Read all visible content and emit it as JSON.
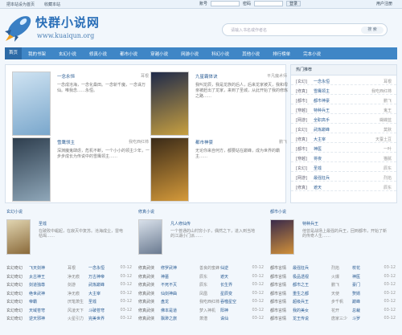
{
  "topbar": {
    "left": [
      "把本站设为首页",
      "收藏本站"
    ],
    "user_label": "账号",
    "pass_label": "密码",
    "login": "登录",
    "register": "用户注册"
  },
  "header": {
    "title": "快群小说网",
    "subtitle": "www.kuaiqun.org"
  },
  "search": {
    "placeholder": "请输入书名或作者名",
    "button": "搜 索"
  },
  "nav": [
    "首页",
    "我的书架",
    "玄幻小说",
    "修真小说",
    "都市小说",
    "穿越小说",
    "网游小说",
    "科幻小说",
    "其他小说",
    "排行榜单",
    "完本小说"
  ],
  "featured": [
    {
      "title": "一念永恒",
      "author": "耳根",
      "desc": "一念成沧海，一念化桑田。一念斩千魔，一念诛万仙。唯我念……永恒。"
    },
    {
      "title": "九星霸体诀",
      "author": "平凡魔术师",
      "desc": "我叫龙辰，我是龙族的后人，后来龙家被灭，我和母亲被赶出了龙家，来到了圣城，从此开始了我的修炼之路……"
    },
    {
      "title": "雪鹰领主",
      "author": "我吃西红柿",
      "desc": "深渊魔鬼肆虐，危机不断，一个小小的领主少年，一步步成长为传说中的雪鹰领主……"
    },
    {
      "title": "都市神豪",
      "author": "鹏飞",
      "desc": "无论你来自何方，都要站在巅峰，成为世界的霸主……"
    }
  ],
  "ranking": {
    "title": "热门推荐",
    "rows": [
      {
        "cat": "[玄幻]",
        "name": "一念永恒",
        "author": "耳根"
      },
      {
        "cat": "[修真]",
        "name": "雪鹰领主",
        "author": "我吃西红柿"
      },
      {
        "cat": "[都市]",
        "name": "都市神豪",
        "author": "鹏飞"
      },
      {
        "cat": "[穿越]",
        "name": "特种兵王",
        "author": "鬼王"
      },
      {
        "cat": "[网游]",
        "name": "全职高手",
        "author": "蝴蝶蓝"
      },
      {
        "cat": "[玄幻]",
        "name": "武炼巅峰",
        "author": "莫默"
      },
      {
        "cat": "[修真]",
        "name": "大主宰",
        "author": "天蚕土豆"
      },
      {
        "cat": "[都市]",
        "name": "神医",
        "author": "一叶"
      },
      {
        "cat": "[穿越]",
        "name": "将夜",
        "author": "猫腻"
      },
      {
        "cat": "[玄幻]",
        "name": "圣墟",
        "author": "辰东"
      },
      {
        "cat": "[网游]",
        "name": "最强狂兵",
        "author": "烈焰"
      },
      {
        "cat": "[修真]",
        "name": "遮天",
        "author": "辰东"
      }
    ]
  },
  "sections": [
    {
      "title": "玄幻小说",
      "feat_title": "圣墟",
      "feat_desc": "在破败中崛起，在寂灭中复苏。沧海成尘，雷电枯竭……",
      "rows": [
        [
          "玄幻奇幻",
          "飞天剑神",
          "耳根",
          "一念永恒",
          "03-12"
        ],
        [
          "玄幻奇幻",
          "太古神王",
          "净无痕",
          "万古神帝",
          "03-12"
        ],
        [
          "玄幻奇幻",
          "剑道独尊",
          "剑游",
          "武炼巅峰",
          "03-12"
        ],
        [
          "玄幻奇幻",
          "绝世武神",
          "净无痕",
          "大主宰",
          "03-12"
        ],
        [
          "玄幻奇幻",
          "帝霸",
          "厌笔萧生",
          "圣墟",
          "03-12"
        ],
        [
          "玄幻奇幻",
          "天域苍穹",
          "风凌天下",
          "斗破苍穹",
          "03-12"
        ],
        [
          "玄幻奇幻",
          "逆天邪神",
          "火星引力",
          "完美世界",
          "03-12"
        ]
      ]
    },
    {
      "title": "修真小说",
      "feat_title": "凡人修仙传",
      "feat_desc": "一个普通的山村穷小子，偶然之下，进入到当地的江湖小门派……",
      "rows": [
        [
          "修真武侠",
          "修罗武神",
          "善良的蜜蜂",
          "仙逆",
          "03-12"
        ],
        [
          "修真武侠",
          "神墓",
          "辰东",
          "遮天",
          "03-12"
        ],
        [
          "修真武侠",
          "不死不灭",
          "辰东",
          "长生界",
          "03-12"
        ],
        [
          "修真武侠",
          "仙剑神曲",
          "凤凰",
          "星辰变",
          "03-12"
        ],
        [
          "修真武侠",
          "盘龙",
          "我吃西红柿",
          "吞噬星空",
          "03-12"
        ],
        [
          "修真武侠",
          "佛本是道",
          "梦入神机",
          "阳神",
          "03-12"
        ],
        [
          "修真武侠",
          "飘渺之旅",
          "萧潜",
          "诛仙",
          "03-12"
        ]
      ]
    },
    {
      "title": "都市小说",
      "feat_title": "特种兵王",
      "feat_desc": "他曾是战场上最强的兵王，回到都市，开始了新的传奇人生……",
      "rows": [
        [
          "都市言情",
          "最强狂兵",
          "烈焰",
          "校花",
          "03-12"
        ],
        [
          "都市言情",
          "极品透视",
          "火爆",
          "神医",
          "03-12"
        ],
        [
          "都市言情",
          "都市之王",
          "鹏飞",
          "豪门",
          "03-12"
        ],
        [
          "都市言情",
          "重生之都",
          "天使",
          "赘婿",
          "03-12"
        ],
        [
          "都市言情",
          "超级兵王",
          "步千帆",
          "巅峰",
          "03-12"
        ],
        [
          "都市言情",
          "我的美女",
          "花开",
          "总裁",
          "03-12"
        ],
        [
          "都市言情",
          "龙王传说",
          "唐家三少",
          "斗罗",
          "03-12"
        ]
      ]
    }
  ]
}
